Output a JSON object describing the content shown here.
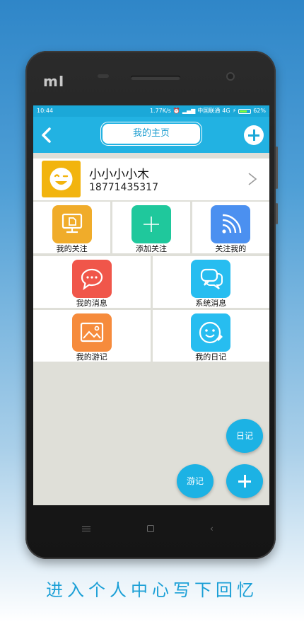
{
  "status": {
    "time": "10:44",
    "speed": "1.77K/s",
    "carrier": "中国联通",
    "network": "4G",
    "battery": "62%"
  },
  "appbar": {
    "title": "我的主页",
    "back_icon": "chevron-left-icon",
    "add_icon": "plus-circle-icon"
  },
  "profile": {
    "name": "小小小小木",
    "phone": "18771435317",
    "avatar_icon": "wink-face-icon"
  },
  "grid": {
    "row1": [
      {
        "label": "我的关注",
        "icon": "monitor-icon",
        "color": "#f0ac2a"
      },
      {
        "label": "添加关注",
        "icon": "plus-icon",
        "color": "#1fc89c"
      },
      {
        "label": "关注我的",
        "icon": "rss-icon",
        "color": "#4b90f0"
      }
    ],
    "row2": [
      {
        "label": "我的消息",
        "icon": "chat-bubble-icon",
        "color": "#f0564a"
      },
      {
        "label": "系统消息",
        "icon": "chat-bubbles-icon",
        "color": "#27bdf0"
      }
    ],
    "row3": [
      {
        "label": "我的游记",
        "icon": "image-icon",
        "color": "#f68b3c"
      },
      {
        "label": "我的日记",
        "icon": "smile-note-icon",
        "color": "#27bdf0"
      }
    ]
  },
  "fabs": {
    "diary": "日记",
    "travel": "游记",
    "add_icon": "plus-icon"
  },
  "caption": "进入个人中心写下回忆"
}
